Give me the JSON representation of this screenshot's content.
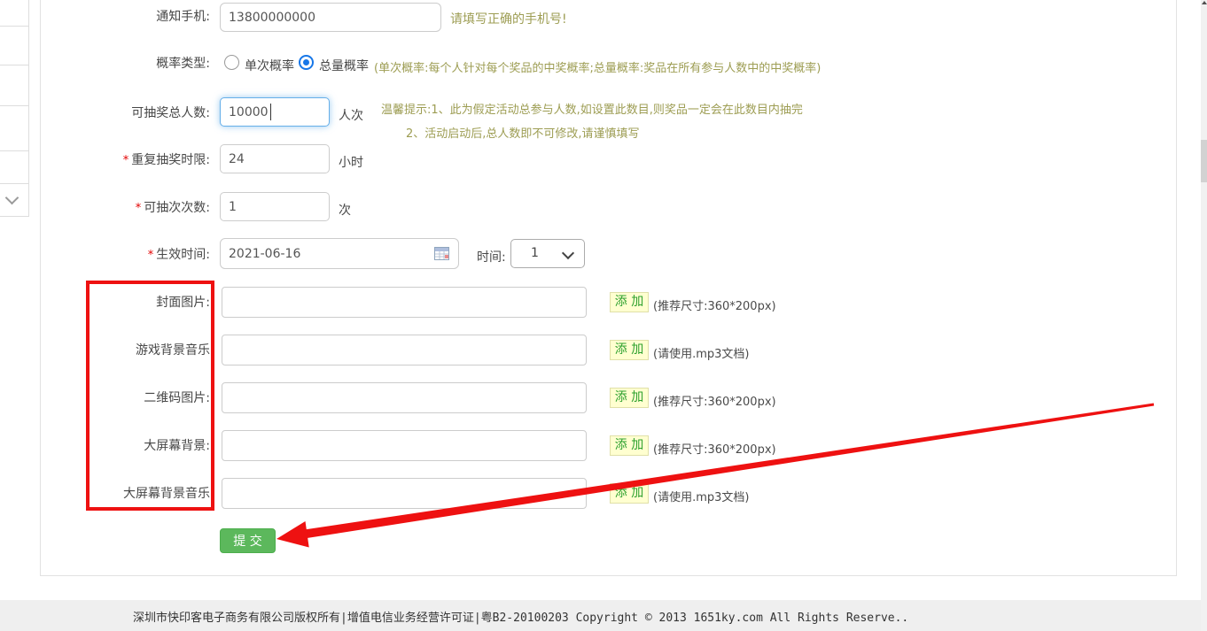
{
  "form": {
    "required_marker": "*",
    "notify_phone": {
      "label": "通知手机:",
      "value": "13800000000",
      "hint": "请填写正确的手机号!"
    },
    "probability": {
      "label": "概率类型:",
      "option_single": "单次概率",
      "option_total": "总量概率",
      "selected": "总量概率",
      "hint": "(单次概率:每个人针对每个奖品的中奖概率;总量概率:奖品在所有参与人数中的中奖概率)"
    },
    "total_people": {
      "label": "可抽奖总人数:",
      "value": "10000",
      "unit": "人次",
      "tip1": "温馨提示:1、此为假定活动总参与人数,如设置此数目,则奖品一定会在此数目内抽完",
      "tip2": "2、活动启动后,总人数即不可修改,请谨慎填写"
    },
    "repeat_limit": {
      "label": "重复抽奖时限:",
      "value": "24",
      "unit": "小时"
    },
    "draw_count": {
      "label": "可抽次次数:",
      "value": "1",
      "unit": "次"
    },
    "effective_date": {
      "label": "生效时间:",
      "value": "2021-06-16",
      "time_label": "时间:",
      "time_value": "1"
    },
    "uploads": [
      {
        "label": "封面图片:",
        "button": "添 加",
        "hint": "(推荐尺寸:360*200px)"
      },
      {
        "label": "游戏背景音乐",
        "button": "添 加",
        "hint": "(请使用.mp3文档)"
      },
      {
        "label": "二维码图片:",
        "button": "添 加",
        "hint": "(推荐尺寸:360*200px)"
      },
      {
        "label": "大屏幕背景:",
        "button": "添 加",
        "hint": "(推荐尺寸:360*200px)"
      },
      {
        "label": "大屏幕背景音乐",
        "button": "添 加",
        "hint": "(请使用.mp3文档)"
      }
    ],
    "submit_label": "提 交"
  },
  "colors": {
    "accent_green": "#5cb85c",
    "annotation_red": "#ee1111",
    "tip_olive": "#9d9d53",
    "radio_blue": "#1777e8",
    "add_button_bg": "#ffffd0"
  },
  "footer": {
    "text": "深圳市快印客电子商务有限公司版权所有|增值电信业务经营许可证|粤B2-20100203 Copyright © 2013 1651ky.com All Rights Reserve.."
  }
}
